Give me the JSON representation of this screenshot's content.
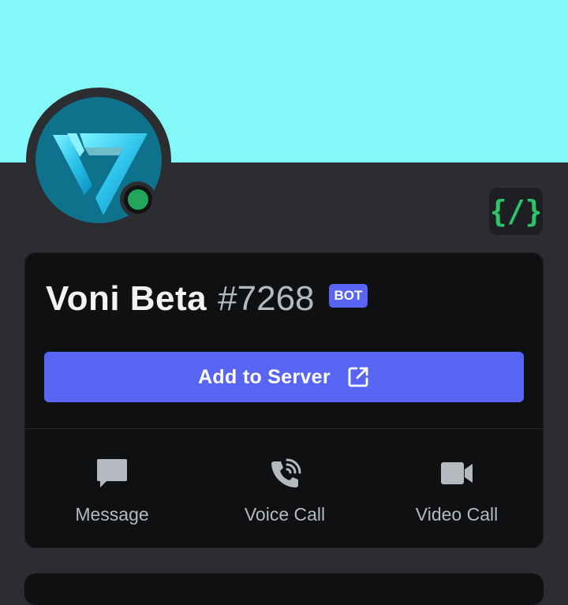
{
  "profile": {
    "username": "Voni Beta",
    "discriminator": "#7268",
    "bot_tag": "BOT",
    "status": "online",
    "avatar_icon": "voni-v-logo-icon",
    "badge_icon": "slash-commands-icon"
  },
  "primary_action": {
    "label": "Add to Server",
    "icon": "external-link-icon"
  },
  "actions": [
    {
      "label": "Message",
      "icon": "message-icon"
    },
    {
      "label": "Voice Call",
      "icon": "phone-icon"
    },
    {
      "label": "Video Call",
      "icon": "video-icon"
    }
  ],
  "colors": {
    "banner": "#84f8f8",
    "accent": "#5865f2",
    "online": "#23a55a",
    "background": "#2b2d31",
    "card": "#0f1012"
  }
}
